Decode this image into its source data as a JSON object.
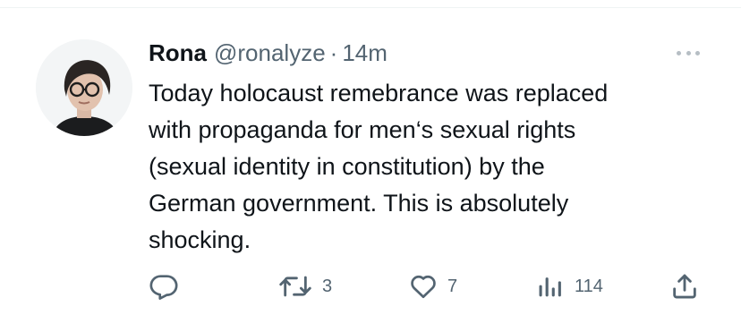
{
  "tweet": {
    "author_name": "Rona",
    "handle": "@ronalyze",
    "separator": "·",
    "time": "14m",
    "text": "Today holocaust remebrance was replaced\nwith propaganda for men‘s sexual rights\n(sexual identity in constitution) by the\nGerman government. This is absolutely\nshocking."
  },
  "actions": {
    "reply_icon": "reply-icon",
    "retweet_icon": "retweet-icon",
    "retweet_count": "3",
    "like_icon": "heart-icon",
    "like_count": "7",
    "views_icon": "views-icon",
    "views_count": "114",
    "share_icon": "share-icon"
  },
  "colors": {
    "text_primary": "#0f1419",
    "text_secondary": "#536471"
  }
}
